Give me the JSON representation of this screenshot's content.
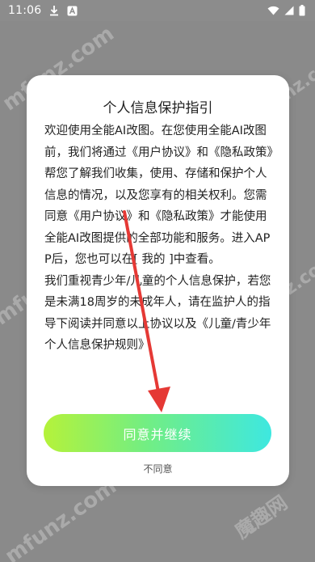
{
  "status_bar": {
    "time": "11:06",
    "icons": [
      "download-icon",
      "app-notification-icon",
      "wifi-icon",
      "signal-icon",
      "battery-icon"
    ]
  },
  "watermarks": [
    "mfunz.com",
    "mfunz.com",
    "mfunz.com",
    "mfunz.com",
    "mfunz.com",
    "魔趣网"
  ],
  "dialog": {
    "title": "个人信息保护指引",
    "paragraph1": "欢迎使用全能AI改图。在您使用全能AI改图前，我们将通过《用户协议》和《隐私政策》帮您了解我们收集，使用、存储和保护个人信息的情况，以及您享有的相关权利。您需同意《用户协议》和《隐私政策》才能使用全能AI改图提供的全部功能和服务。进入APP后，您也可以在[ 我的 ]中查看。",
    "paragraph2": "我们重视青少年/儿童的个人信息保护，若您是未满18周岁的未成年人，请在监护人的指导下阅读并同意以上协议以及《儿童/青少年个人信息保护规则》",
    "agree_label": "同意并继续",
    "disagree_label": "不同意"
  },
  "colors": {
    "overlay": "#8a8a8a",
    "button_gradient": [
      "#b5f23a",
      "#72ee83",
      "#3ee8e0"
    ],
    "annotation_arrow": "#e53935"
  }
}
